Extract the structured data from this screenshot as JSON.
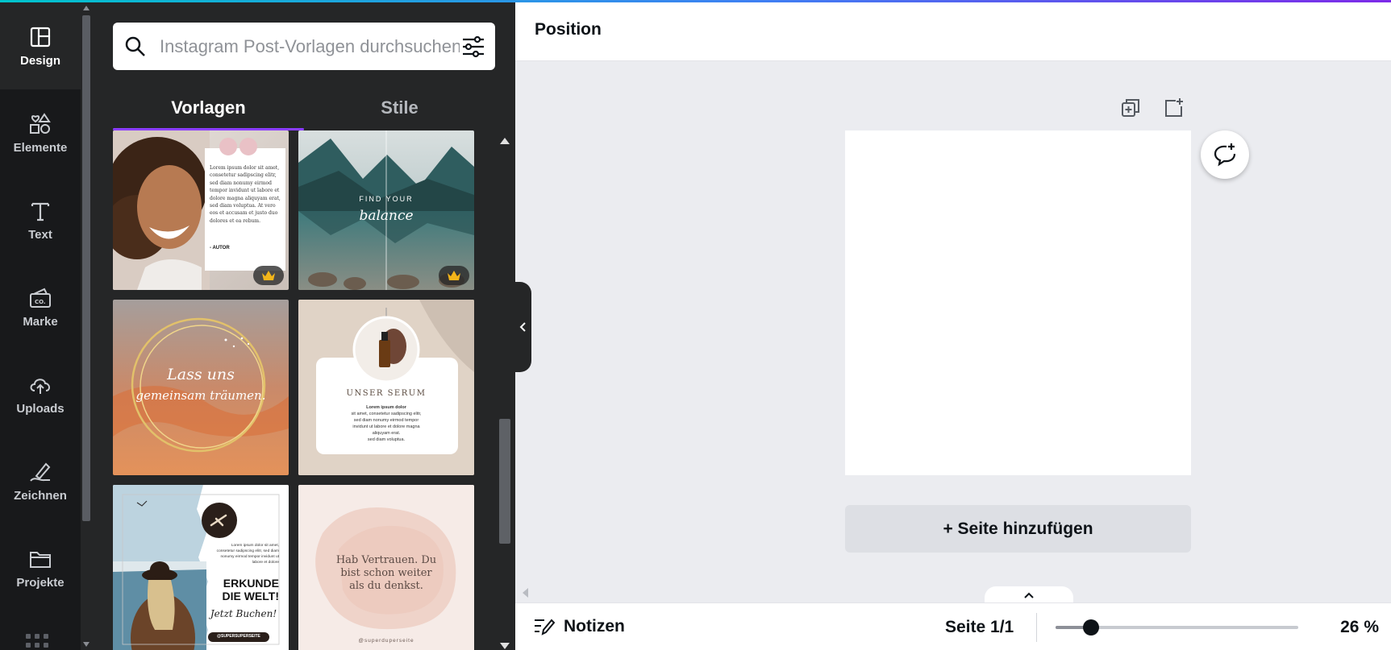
{
  "rail": {
    "items": [
      {
        "label": "Design",
        "icon": "layout-icon"
      },
      {
        "label": "Elemente",
        "icon": "shapes-icon"
      },
      {
        "label": "Text",
        "icon": "text-icon"
      },
      {
        "label": "Marke",
        "icon": "brand-icon"
      },
      {
        "label": "Uploads",
        "icon": "cloud-upload-icon"
      },
      {
        "label": "Zeichnen",
        "icon": "pen-icon"
      },
      {
        "label": "Projekte",
        "icon": "folder-icon"
      }
    ]
  },
  "search": {
    "placeholder": "Instagram Post-Vorlagen durchsuchen"
  },
  "tabs": [
    {
      "label": "Vorlagen"
    },
    {
      "label": "Stile"
    }
  ],
  "templates": {
    "t1": {
      "body": "Lorem ipsum dolor sit amet, consetetur sadipscing elitr, sed diam nonumy eirmod tempor invidunt ut labore et dolore magna aliquyam erat, sed diam voluptua. At vero eos et accusam et justo duo dolores et ea rebum.",
      "author": "- AUTOR"
    },
    "t2": {
      "line1": "FIND YOUR",
      "line2": "balance"
    },
    "t3": {
      "line1": "Lass uns",
      "line2": "gemeinsam träumen."
    },
    "t4": {
      "title": "UNSER SERUM",
      "body1": "Lorem ipsum dolor",
      "body2": "sit amet, consetetur sadipscing elitr,",
      "body3": "sed diam nonumy eirmod tempor",
      "body4": "invidunt ut labore et dolore magna",
      "body5": "aliquyam erat.",
      "body6": "sed diam voluptua."
    },
    "t5": {
      "body": "Lorem ipsum dolor sit amet, consetetur sadipscing elitr, sed diam nonumy eirmod tempor invidunt ut labore et dolore",
      "heading1": "ERKUNDE",
      "heading2": "DIE WELT!",
      "script": "Jetzt Buchen!",
      "handle": "@SUPERSUPERSEITE"
    },
    "t6": {
      "line1": "Hab Vertrauen. Du",
      "line2": "bist schon weiter",
      "line3": "als du denkst.",
      "handle": "@superduperseite"
    }
  },
  "header": {
    "title": "Position"
  },
  "canvas": {
    "add_page": "+ Seite hinzufügen"
  },
  "footer": {
    "notes": "Notizen",
    "page": "Seite 1/1",
    "zoom": "26 %",
    "zoom_level": 0.26
  },
  "colors": {
    "accent": "#8b3dff",
    "rail": "#18191b",
    "panel": "#252627",
    "workspace": "#ebecf0",
    "crown": "#f3b51a"
  }
}
